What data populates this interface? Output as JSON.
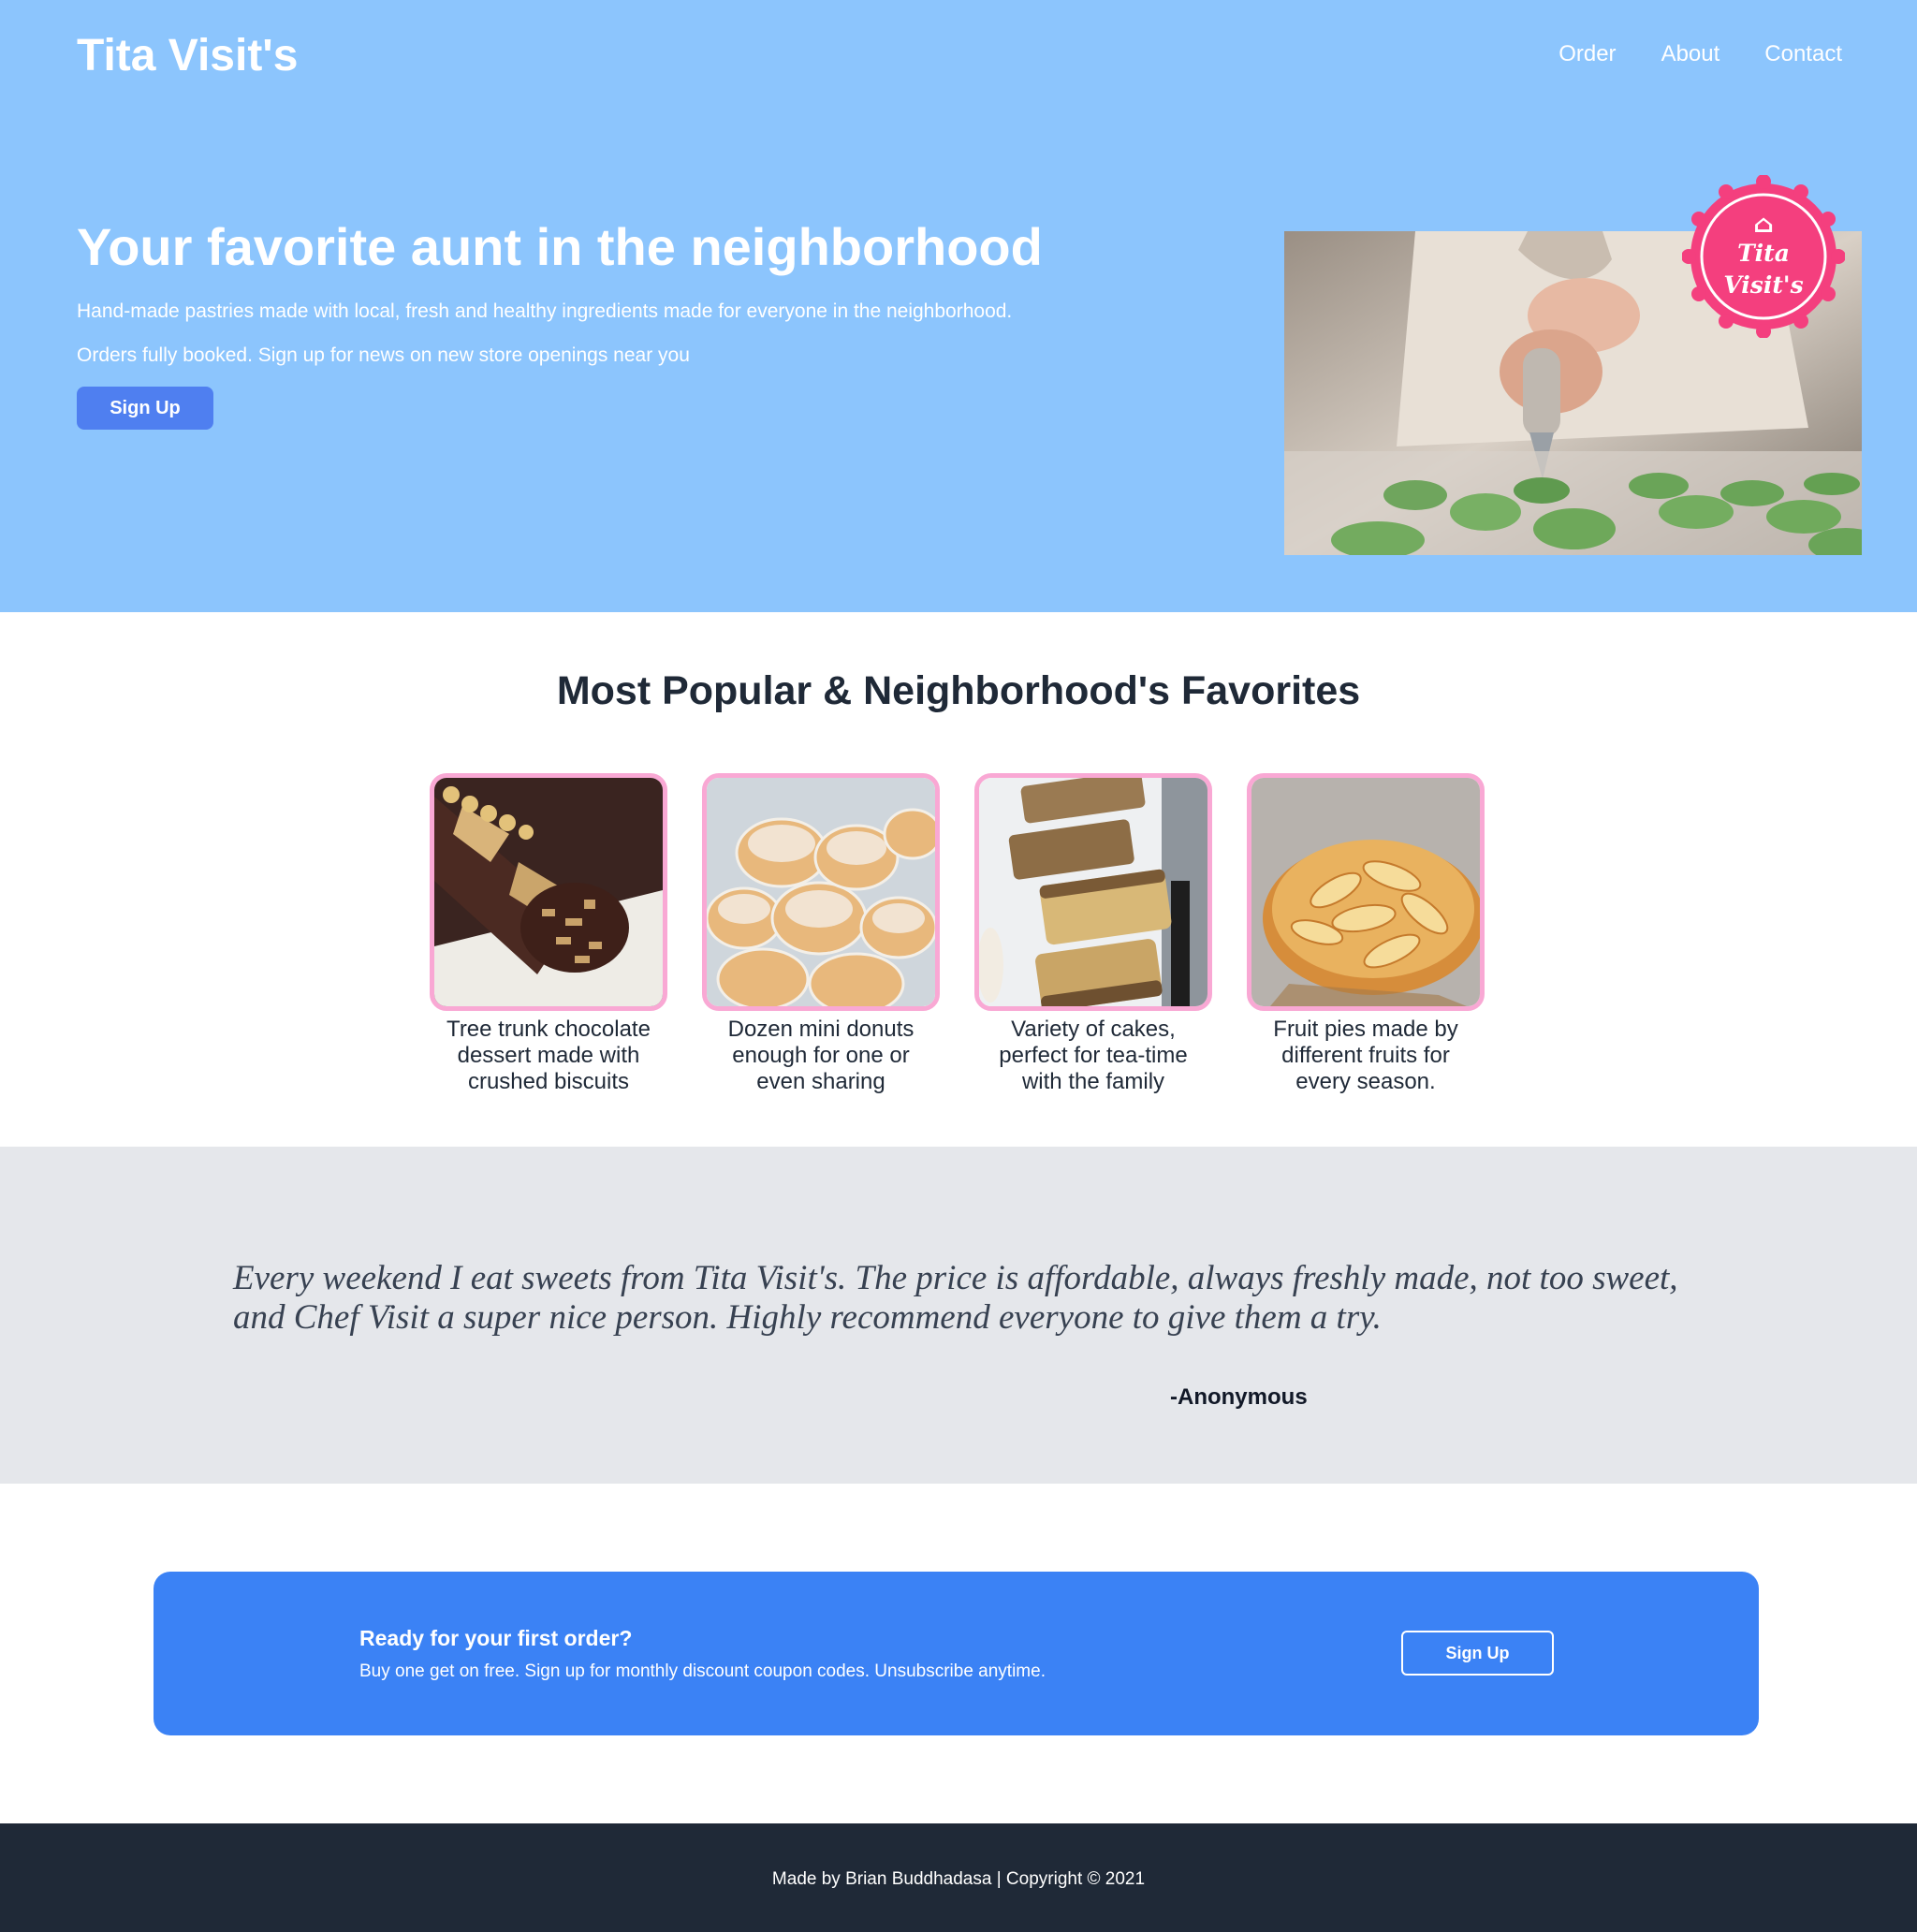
{
  "header": {
    "brand": "Tita Visit's",
    "nav": [
      "Order",
      "About",
      "Contact"
    ]
  },
  "hero": {
    "title": "Your favorite aunt in the neighborhood",
    "description": "Hand-made pastries made with local, fresh and healthy ingredients made for everyone in the neighborhood.",
    "subtext": "Orders fully booked. Sign up for news on new store openings near you",
    "button": "Sign Up",
    "image_icon": "piping-macarons-photo",
    "badge": {
      "icon": "cupcake-icon",
      "line1": "Tita",
      "line2": "Visit's"
    }
  },
  "popular": {
    "title": "Most Popular & Neighborhood's Favorites",
    "products": [
      {
        "caption": "Tree trunk chocolate dessert made with crushed biscuits",
        "image_icon": "chocolate-log-photo"
      },
      {
        "caption": "Dozen mini donuts enough for one or even sharing",
        "image_icon": "mini-donuts-photo"
      },
      {
        "caption": "Variety of cakes, perfect for tea-time with the family",
        "image_icon": "pound-cake-photo"
      },
      {
        "caption": "Fruit pies made by different fruits for every season.",
        "image_icon": "apple-pie-photo"
      }
    ]
  },
  "testimonial": {
    "quote": "Every weekend I eat sweets from Tita Visit's. The price is affordable, always freshly made, not too sweet, and Chef Visit a super nice person. Highly recommend everyone to give them a try.",
    "author": "-Anonymous"
  },
  "cta": {
    "title": "Ready for your first order?",
    "text": "Buy one get on free. Sign up for monthly discount coupon codes. Unsubscribe anytime.",
    "button": "Sign Up"
  },
  "footer": {
    "text": "Made by Brian Buddhadasa | Copyright © 2021"
  },
  "colors": {
    "hero_bg": "#8cc5fd",
    "hero_button": "#4f7ff0",
    "badge": "#f43f7e",
    "product_border": "#f9a8d4",
    "testimonial_bg": "#e5e7eb",
    "cta_bg": "#3b82f5",
    "footer_bg": "#1f2937"
  }
}
